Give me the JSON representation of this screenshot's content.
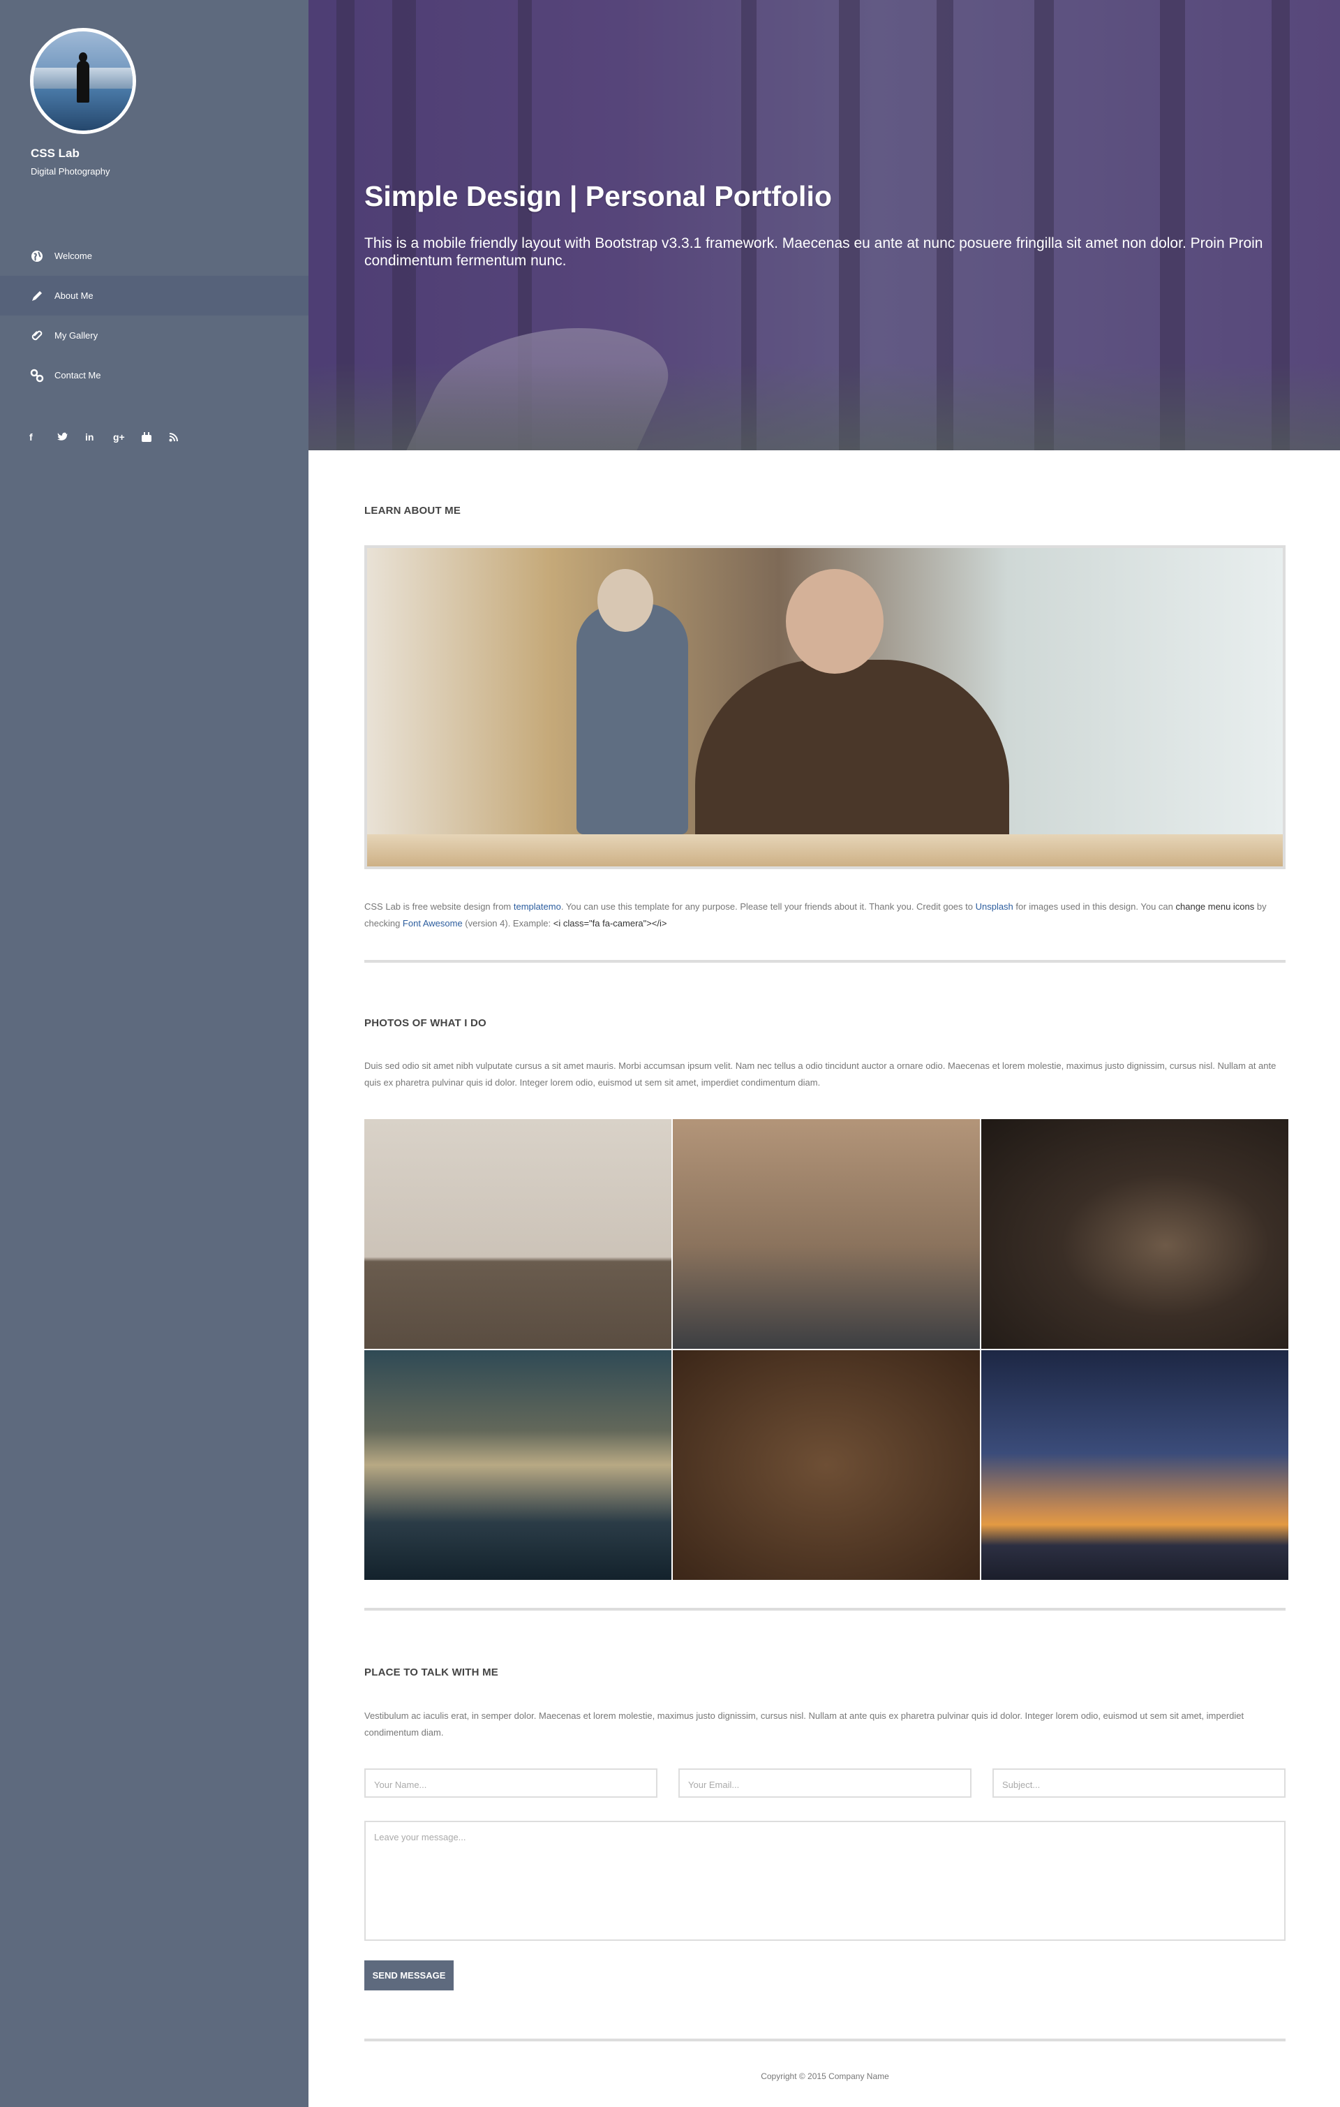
{
  "sidebar": {
    "brand": "CSS Lab",
    "tagline": "Digital Photography",
    "menu": [
      {
        "label": "Welcome",
        "icon": "globe-icon"
      },
      {
        "label": "About Me",
        "icon": "pencil-icon"
      },
      {
        "label": "My Gallery",
        "icon": "paperclip-icon"
      },
      {
        "label": "Contact Me",
        "icon": "link-icon"
      }
    ],
    "social": [
      "f",
      "t",
      "in",
      "g+",
      "yt",
      "rss"
    ],
    "colors": {
      "background": "#5e6a7e",
      "active": "#56627a"
    }
  },
  "hero": {
    "title": "Simple Design | Personal Portfolio",
    "text": "This is a mobile friendly layout with Bootstrap v3.3.1 framework. Maecenas eu ante at nunc posuere fringilla sit amet non dolor. Proin Proin condimentum fermentum nunc."
  },
  "about": {
    "heading": "LEARN ABOUT ME",
    "t1": "CSS Lab is free website design from ",
    "link1": "templatemo",
    "t2": ". You can use this template for any purpose. Please tell your friends about it. Thank you. Credit goes to ",
    "link2": "Unsplash",
    "t3": " for images used in this design. You can ",
    "b1": "change menu icons",
    "t4": " by checking ",
    "link3": "Font Awesome",
    "t5": " (version 4). Example: ",
    "code": "<i class=\"fa fa-camera\"></i>"
  },
  "photos": {
    "heading": "PHOTOS OF WHAT I DO",
    "text": "Duis sed odio sit amet nibh vulputate cursus a sit amet mauris. Morbi accumsan ipsum velit. Nam nec tellus a odio tincidunt auctor a ornare odio. Maecenas et lorem molestie, maximus justo dignissim, cursus nisl. Nullam at ante quis ex pharetra pulvinar quis id dolor. Integer lorem odio, euismod ut sem sit amet, imperdiet condimentum diam."
  },
  "contact": {
    "heading": "PLACE TO TALK WITH ME",
    "text": "Vestibulum ac iaculis erat, in semper dolor. Maecenas et lorem molestie, maximus justo dignissim, cursus nisl. Nullam at ante quis ex pharetra pulvinar quis id dolor. Integer lorem odio, euismod ut sem sit amet, imperdiet condimentum diam.",
    "name_placeholder": "Your Name...",
    "email_placeholder": "Your Email...",
    "subject_placeholder": "Subject...",
    "message_placeholder": "Leave your message...",
    "send_label": "SEND MESSAGE"
  },
  "footer": {
    "copyright": "Copyright © 2015 Company Name"
  }
}
